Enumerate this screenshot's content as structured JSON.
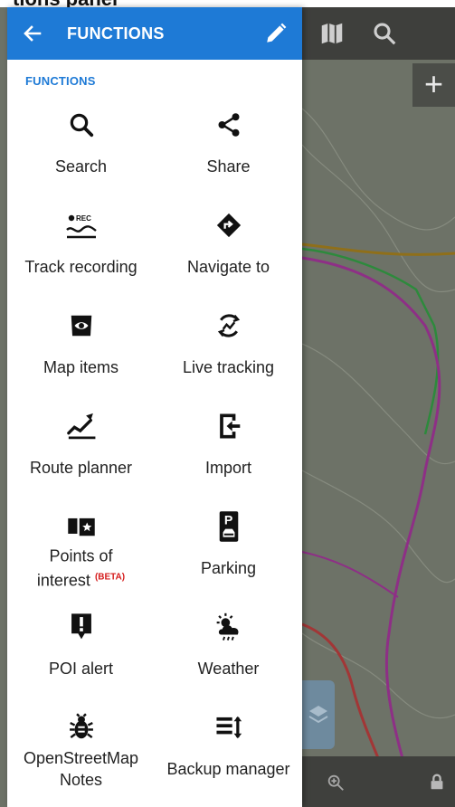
{
  "top_strip_text": "tions panel",
  "appbar": {
    "title": "FUNCTIONS"
  },
  "section_label": "FUNCTIONS",
  "functions": [
    {
      "label": "Search",
      "icon": "search-icon"
    },
    {
      "label": "Share",
      "icon": "share-icon"
    },
    {
      "label": "Track recording",
      "icon": "track-recording-icon"
    },
    {
      "label": "Navigate to",
      "icon": "navigate-icon"
    },
    {
      "label": "Map items",
      "icon": "map-items-icon"
    },
    {
      "label": "Live tracking",
      "icon": "live-tracking-icon"
    },
    {
      "label": "Route planner",
      "icon": "route-planner-icon"
    },
    {
      "label": "Import",
      "icon": "import-icon"
    },
    {
      "label_line1": "Points of",
      "label_line2": "interest",
      "badge": "(BETA)",
      "icon": "points-of-interest-icon"
    },
    {
      "label": "Parking",
      "icon": "parking-icon"
    },
    {
      "label": "POI alert",
      "icon": "poi-alert-icon"
    },
    {
      "label": "Weather",
      "icon": "weather-icon"
    },
    {
      "label_line1": "OpenStreetMap",
      "label_line2": "Notes",
      "icon": "bug-icon"
    },
    {
      "label": "Backup manager",
      "icon": "backup-manager-icon"
    }
  ],
  "colors": {
    "accent": "#1e7ad6",
    "badge": "#d51c1c"
  }
}
